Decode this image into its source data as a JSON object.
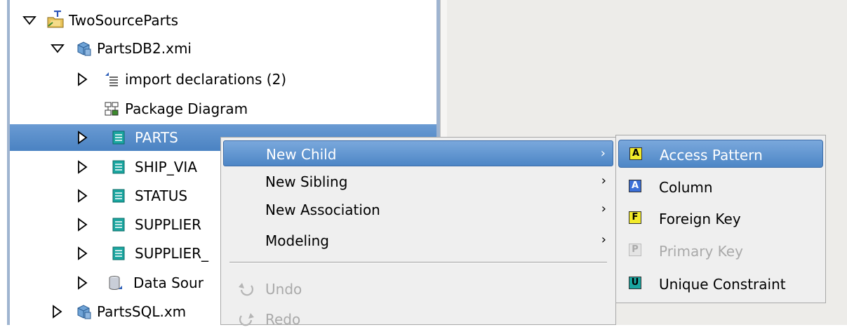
{
  "tree": {
    "items": [
      {
        "label": "TwoSourceParts",
        "icon": "project-icon",
        "expanded": true
      },
      {
        "label": "PartsDB2.xmi",
        "icon": "model-file-icon",
        "expanded": true
      },
      {
        "label": "import declarations (2)",
        "icon": "import-icon",
        "expanded": false
      },
      {
        "label": "Package Diagram",
        "icon": "diagram-icon"
      },
      {
        "label": "PARTS",
        "icon": "table-icon",
        "expanded": false,
        "selected": true
      },
      {
        "label": "SHIP_VIA",
        "icon": "table-icon",
        "expanded": false
      },
      {
        "label": "STATUS",
        "icon": "table-icon",
        "expanded": false
      },
      {
        "label": "SUPPLIER",
        "icon": "table-icon",
        "expanded": false
      },
      {
        "label": "SUPPLIER_",
        "icon": "table-icon",
        "expanded": false
      },
      {
        "label": "Data Sour",
        "icon": "datasource-icon",
        "expanded": false
      },
      {
        "label": "PartsSQL.xm",
        "icon": "model-file-icon",
        "expanded": false
      }
    ]
  },
  "context_menu": {
    "items": [
      {
        "label": "New Child",
        "has_submenu": true,
        "active": true
      },
      {
        "label": "New Sibling",
        "has_submenu": true
      },
      {
        "label": "New Association",
        "has_submenu": true
      },
      {
        "label": "Modeling",
        "has_submenu": true
      },
      {
        "label": "Undo",
        "enabled": false,
        "icon": "undo-icon"
      },
      {
        "label": "Redo",
        "enabled": false,
        "icon": "redo-icon"
      }
    ],
    "submenu_arrow": "›"
  },
  "submenu": {
    "items": [
      {
        "label": "Access Pattern",
        "letter": "A",
        "badge_color": "#f2ea2a",
        "active": true
      },
      {
        "label": "Column",
        "letter": "A",
        "badge_color": "#3b6fd8"
      },
      {
        "label": "Foreign Key",
        "letter": "F",
        "badge_color": "#f2ea2a"
      },
      {
        "label": "Primary Key",
        "letter": "P",
        "badge_color": "#e4e4e4",
        "enabled": false
      },
      {
        "label": "Unique Constraint",
        "letter": "U",
        "badge_color": "#1aa6a0"
      }
    ]
  },
  "colors": {
    "selection": "#4a82c2",
    "menu_bg": "#efefef",
    "panel_bg": "#edece9"
  }
}
